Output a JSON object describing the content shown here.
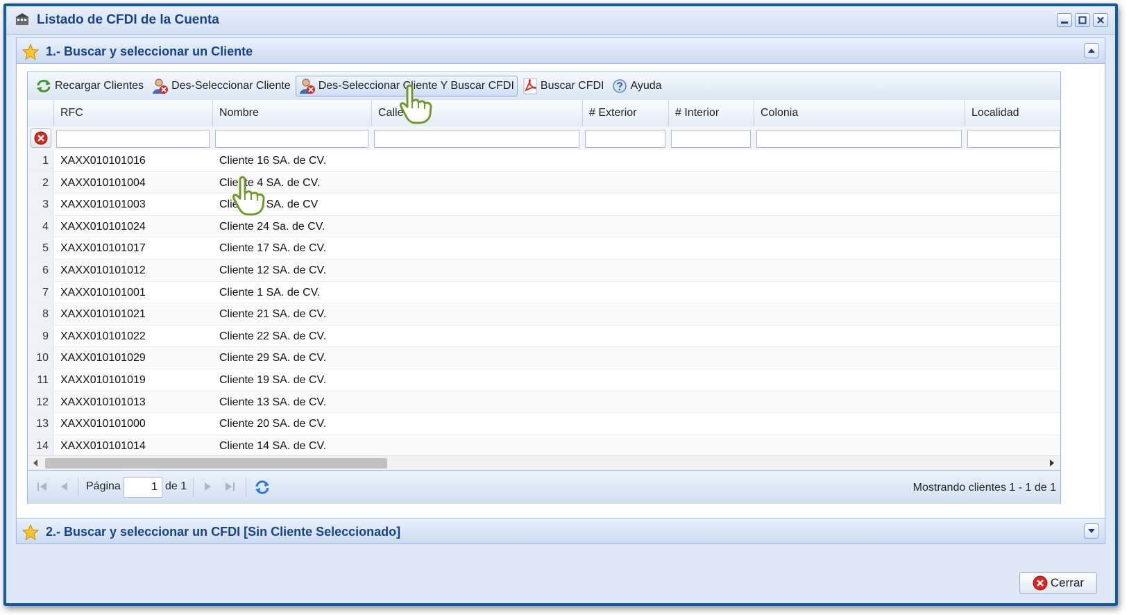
{
  "window": {
    "title": "Listado de CFDI de la Cuenta"
  },
  "section1": {
    "title": "1.- Buscar y seleccionar un Cliente"
  },
  "section2": {
    "title": "2.- Buscar y seleccionar un CFDI [Sin Cliente Seleccionado]"
  },
  "toolbar": {
    "reload": "Recargar Clientes",
    "deselect": "Des-Seleccionar Cliente",
    "deselect_search": "Des-Seleccionar Cliente Y Buscar CFDI",
    "search_cfdi": "Buscar CFDI",
    "help": "Ayuda"
  },
  "grid": {
    "columns": [
      "RFC",
      "Nombre",
      "Calle",
      "# Exterior",
      "# Interior",
      "Colonia",
      "Localidad"
    ],
    "rows": [
      {
        "num": "1",
        "rfc": "XAXX010101016",
        "nombre": "Cliente 16 SA. de CV."
      },
      {
        "num": "2",
        "rfc": "XAXX010101004",
        "nombre": "Cliente 4 SA. de CV."
      },
      {
        "num": "3",
        "rfc": "XAXX010101003",
        "nombre": "Cliente 3 SA. de CV"
      },
      {
        "num": "4",
        "rfc": "XAXX010101024",
        "nombre": "Cliente 24 Sa. de CV."
      },
      {
        "num": "5",
        "rfc": "XAXX010101017",
        "nombre": "Cliente 17 SA. de CV."
      },
      {
        "num": "6",
        "rfc": "XAXX010101012",
        "nombre": "Cliente 12 SA. de CV."
      },
      {
        "num": "7",
        "rfc": "XAXX010101001",
        "nombre": "Cliente 1 SA. de CV."
      },
      {
        "num": "8",
        "rfc": "XAXX010101021",
        "nombre": "Cliente 21 SA. de CV."
      },
      {
        "num": "9",
        "rfc": "XAXX010101022",
        "nombre": "Cliente 22 SA. de CV."
      },
      {
        "num": "10",
        "rfc": "XAXX010101029",
        "nombre": "Cliente 29 SA. de CV."
      },
      {
        "num": "11",
        "rfc": "XAXX010101019",
        "nombre": "Cliente 19 SA. de CV."
      },
      {
        "num": "12",
        "rfc": "XAXX010101013",
        "nombre": "Cliente 13 SA. de CV."
      },
      {
        "num": "13",
        "rfc": "XAXX010101000",
        "nombre": "Cliente 20 SA. de CV."
      },
      {
        "num": "14",
        "rfc": "XAXX010101014",
        "nombre": "Cliente 14 SA. de CV."
      }
    ]
  },
  "pager": {
    "page_label": "Página",
    "page_value": "1",
    "of_label": "de 1",
    "status": "Mostrando clientes 1 - 1 de 1"
  },
  "footer": {
    "close_label": "Cerrar"
  },
  "icons": {
    "title": "app-window-icon",
    "reload": "reload-icon",
    "user_remove": "user-remove-icon",
    "pdf": "pdf-icon",
    "help": "help-icon",
    "star": "star-icon",
    "clear_filters": "clear-filters-icon",
    "close": "close-icon",
    "pointer": "hand-pointer-icon"
  },
  "colors": {
    "accent": "#15428b",
    "border": "#0f5aa8",
    "panel": "#dfe8f6",
    "danger": "#d9261c"
  }
}
